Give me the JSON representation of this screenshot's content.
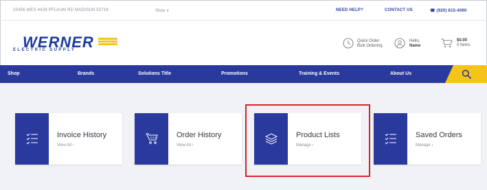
{
  "topbar": {
    "address": "23456 WES 4428 PFLAUM RD MADISON 53716",
    "store": "Store ∨",
    "need_help": "NEED HELP?",
    "contact_us": "CONTACT US",
    "phone": "☎ (920) 815-4090"
  },
  "header": {
    "logo_word": "WERNER",
    "logo_sub": "ELECTRIC SUPPLY",
    "quick_order_title": "Quick Order",
    "quick_order_sub": "Bulk Ordering",
    "hello_label": "Hello,",
    "user_name": "Name",
    "cart_total": "$0.00",
    "cart_items": "0 Items"
  },
  "nav": {
    "items": [
      "Shop",
      "Brands",
      "Solutions Title",
      "Promotions",
      "Training & Events",
      "About Us"
    ]
  },
  "cards": [
    {
      "title": "Invoice History",
      "link": "View All ›",
      "icon": "checklist-icon"
    },
    {
      "title": "Order History",
      "link": "View All ›",
      "icon": "cart-icon"
    },
    {
      "title": "Product Lists",
      "link": "Manage ›",
      "icon": "stacked-layers-icon"
    },
    {
      "title": "Saved Orders",
      "link": "Manage ›",
      "icon": "checklist-icon"
    }
  ],
  "colors": {
    "brand_blue": "#2a3a9c",
    "accent_yellow": "#f6c31a",
    "highlight_red": "#d2232a"
  }
}
